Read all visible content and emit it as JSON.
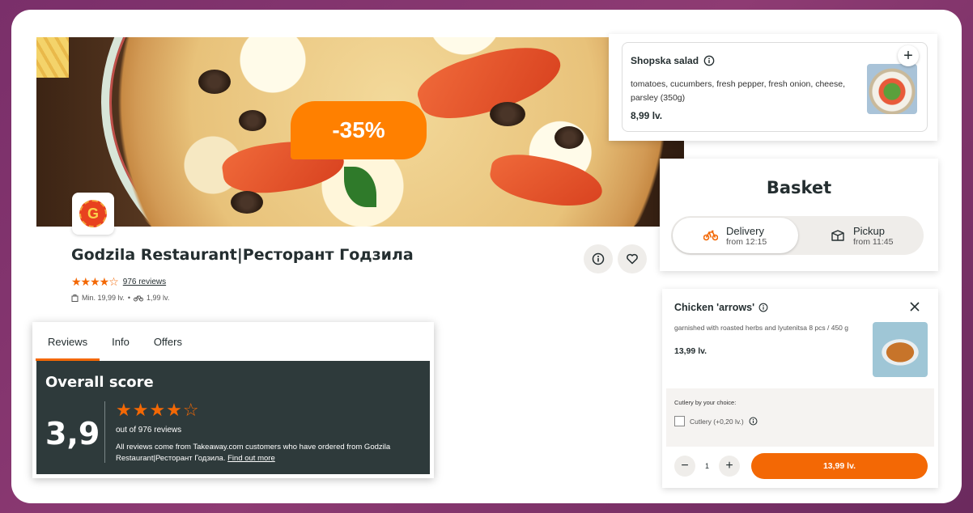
{
  "colors": {
    "accent": "#f36805",
    "dark_panel": "#2e3a3b",
    "background": "#8e3b73"
  },
  "hero": {
    "discount": "-35%",
    "logo_letter": "G"
  },
  "restaurant": {
    "name": "Godzila Restaurant|Ресторант Годзила",
    "stars_text": "★★★★☆",
    "reviews_link": "976 reviews",
    "min_order": "Min. 19,99 lv.",
    "separator": "•",
    "delivery_fee": "1,99 lv."
  },
  "reviews": {
    "tabs": [
      {
        "label": "Reviews"
      },
      {
        "label": "Info"
      },
      {
        "label": "Offers"
      }
    ],
    "overall_title": "Overall score",
    "score": "3,9",
    "stars_text": "★★★★☆",
    "out_of": "out of 976 reviews",
    "note": "All reviews come from Takeaway.com customers who have ordered from Godzila Restaurant|Ресторант Годзила.",
    "find_out_more": "Find out more"
  },
  "shopska": {
    "title": "Shopska salad",
    "description": "tomatoes, cucumbers, fresh pepper, fresh onion, cheese, parsley (350g)",
    "price": "8,99 lv.",
    "add_icon": "plus-icon"
  },
  "basket": {
    "title": "Basket",
    "delivery": {
      "label": "Delivery",
      "sub": "from 12:15",
      "icon": "bike-icon"
    },
    "pickup": {
      "label": "Pickup",
      "sub": "from 11:45",
      "icon": "bag-icon"
    }
  },
  "chicken": {
    "title": "Chicken 'arrows'",
    "description": "garnished with roasted herbs and lyutenitsa 8 pcs / 450 g",
    "price": "13,99 lv.",
    "cutlery_label": "Cutlery by your choice:",
    "cutlery_option": "Cutlery (+0,20 lv.)",
    "quantity": "1",
    "minus": "−",
    "plus": "+",
    "add_button": "13,99 lv."
  }
}
